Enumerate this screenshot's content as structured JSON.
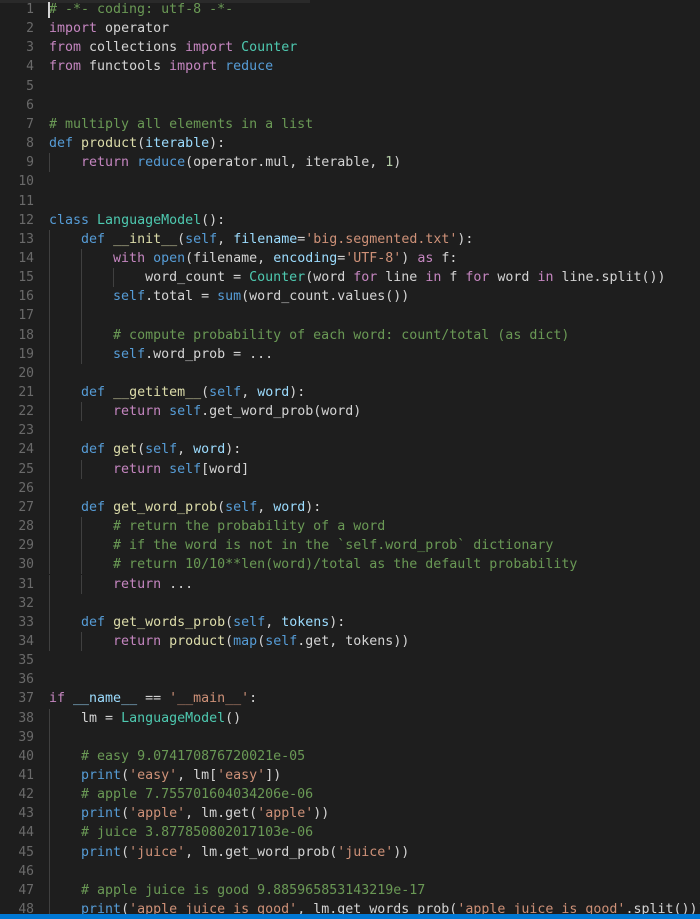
{
  "editor": {
    "language": "python",
    "theme": "dark-plus",
    "background_color": "#1e1e1e",
    "gutter_color": "#6a6a6a",
    "indent_guide_color": "#404040",
    "cursor_line": 1,
    "cursor_column": 1,
    "status_bar_color": "#0078d4",
    "total_visible_lines": 48,
    "colors": {
      "comment": "#6a9955",
      "keyword": "#c586c0",
      "declaration": "#569cd6",
      "string": "#ce9178",
      "function": "#dcdcaa",
      "class": "#4ec9b0",
      "number": "#b5cea8",
      "variable": "#9cdcfe",
      "plain": "#d4d4d4"
    }
  },
  "lines": [
    {
      "n": 1,
      "indent": 0,
      "text": "# -*- coding: utf-8 -*-",
      "tokens": [
        {
          "t": "# -*- coding: utf-8 -*-",
          "c": "t-comment"
        }
      ]
    },
    {
      "n": 2,
      "indent": 0,
      "text": "import operator",
      "tokens": [
        {
          "t": "import",
          "c": "t-keyword"
        },
        {
          "t": " operator",
          "c": "t-plain"
        }
      ]
    },
    {
      "n": 3,
      "indent": 0,
      "text": "from collections import Counter",
      "tokens": [
        {
          "t": "from",
          "c": "t-keyword"
        },
        {
          "t": " collections ",
          "c": "t-plain"
        },
        {
          "t": "import",
          "c": "t-keyword"
        },
        {
          "t": " ",
          "c": "t-plain"
        },
        {
          "t": "Counter",
          "c": "t-builtin"
        }
      ]
    },
    {
      "n": 4,
      "indent": 0,
      "text": "from functools import reduce",
      "tokens": [
        {
          "t": "from",
          "c": "t-keyword"
        },
        {
          "t": " functools ",
          "c": "t-plain"
        },
        {
          "t": "import",
          "c": "t-keyword"
        },
        {
          "t": " ",
          "c": "t-plain"
        },
        {
          "t": "reduce",
          "c": "t-declare"
        }
      ]
    },
    {
      "n": 5,
      "indent": 0,
      "text": "",
      "tokens": []
    },
    {
      "n": 6,
      "indent": 0,
      "text": "",
      "tokens": []
    },
    {
      "n": 7,
      "indent": 0,
      "text": "# multiply all elements in a list",
      "tokens": [
        {
          "t": "# multiply all elements in a list",
          "c": "t-comment"
        }
      ]
    },
    {
      "n": 8,
      "indent": 0,
      "text": "def product(iterable):",
      "tokens": [
        {
          "t": "def",
          "c": "t-declare"
        },
        {
          "t": " ",
          "c": "t-plain"
        },
        {
          "t": "product",
          "c": "t-func"
        },
        {
          "t": "(",
          "c": "t-plain"
        },
        {
          "t": "iterable",
          "c": "t-param"
        },
        {
          "t": "):",
          "c": "t-plain"
        }
      ]
    },
    {
      "n": 9,
      "indent": 1,
      "text": "    return reduce(operator.mul, iterable, 1)",
      "tokens": [
        {
          "t": "    ",
          "c": "t-plain"
        },
        {
          "t": "return",
          "c": "t-ctrl"
        },
        {
          "t": " ",
          "c": "t-plain"
        },
        {
          "t": "reduce",
          "c": "t-declare"
        },
        {
          "t": "(operator.mul, iterable, ",
          "c": "t-plain"
        },
        {
          "t": "1",
          "c": "t-number"
        },
        {
          "t": ")",
          "c": "t-plain"
        }
      ]
    },
    {
      "n": 10,
      "indent": 0,
      "text": "",
      "tokens": []
    },
    {
      "n": 11,
      "indent": 0,
      "text": "",
      "tokens": []
    },
    {
      "n": 12,
      "indent": 0,
      "text": "class LanguageModel():",
      "tokens": [
        {
          "t": "class",
          "c": "t-declare"
        },
        {
          "t": " ",
          "c": "t-plain"
        },
        {
          "t": "LanguageModel",
          "c": "t-class"
        },
        {
          "t": "():",
          "c": "t-plain"
        }
      ]
    },
    {
      "n": 13,
      "indent": 1,
      "text": "    def __init__(self, filename='big.segmented.txt'):",
      "tokens": [
        {
          "t": "    ",
          "c": "t-plain"
        },
        {
          "t": "def",
          "c": "t-declare"
        },
        {
          "t": " ",
          "c": "t-plain"
        },
        {
          "t": "__init__",
          "c": "t-func"
        },
        {
          "t": "(",
          "c": "t-plain"
        },
        {
          "t": "self",
          "c": "t-declare"
        },
        {
          "t": ", ",
          "c": "t-plain"
        },
        {
          "t": "filename",
          "c": "t-param"
        },
        {
          "t": "=",
          "c": "t-plain"
        },
        {
          "t": "'big.segmented.txt'",
          "c": "t-string"
        },
        {
          "t": "):",
          "c": "t-plain"
        }
      ]
    },
    {
      "n": 14,
      "indent": 2,
      "text": "        with open(filename, encoding='UTF-8') as f:",
      "tokens": [
        {
          "t": "        ",
          "c": "t-plain"
        },
        {
          "t": "with",
          "c": "t-keyword"
        },
        {
          "t": " ",
          "c": "t-plain"
        },
        {
          "t": "open",
          "c": "t-declare"
        },
        {
          "t": "(filename, ",
          "c": "t-plain"
        },
        {
          "t": "encoding",
          "c": "t-param"
        },
        {
          "t": "=",
          "c": "t-plain"
        },
        {
          "t": "'UTF-8'",
          "c": "t-string"
        },
        {
          "t": ") ",
          "c": "t-plain"
        },
        {
          "t": "as",
          "c": "t-keyword"
        },
        {
          "t": " f:",
          "c": "t-plain"
        }
      ]
    },
    {
      "n": 15,
      "indent": 3,
      "text": "            word_count = Counter(word for line in f for word in line.split())",
      "tokens": [
        {
          "t": "            word_count = ",
          "c": "t-plain"
        },
        {
          "t": "Counter",
          "c": "t-builtin"
        },
        {
          "t": "(word ",
          "c": "t-plain"
        },
        {
          "t": "for",
          "c": "t-keyword"
        },
        {
          "t": " line ",
          "c": "t-plain"
        },
        {
          "t": "in",
          "c": "t-keyword"
        },
        {
          "t": " f ",
          "c": "t-plain"
        },
        {
          "t": "for",
          "c": "t-keyword"
        },
        {
          "t": " word ",
          "c": "t-plain"
        },
        {
          "t": "in",
          "c": "t-keyword"
        },
        {
          "t": " line.split())",
          "c": "t-plain"
        }
      ]
    },
    {
      "n": 16,
      "indent": 2,
      "text": "        self.total = sum(word_count.values())",
      "tokens": [
        {
          "t": "        ",
          "c": "t-plain"
        },
        {
          "t": "self",
          "c": "t-declare"
        },
        {
          "t": ".total = ",
          "c": "t-plain"
        },
        {
          "t": "sum",
          "c": "t-declare"
        },
        {
          "t": "(word_count.values())",
          "c": "t-plain"
        }
      ]
    },
    {
      "n": 17,
      "indent": 2,
      "text": "",
      "tokens": []
    },
    {
      "n": 18,
      "indent": 2,
      "text": "        # compute probability of each word: count/total (as dict)",
      "tokens": [
        {
          "t": "        ",
          "c": "t-plain"
        },
        {
          "t": "# compute probability of each word: count/total (as dict)",
          "c": "t-comment"
        }
      ]
    },
    {
      "n": 19,
      "indent": 2,
      "text": "        self.word_prob = ...",
      "tokens": [
        {
          "t": "        ",
          "c": "t-plain"
        },
        {
          "t": "self",
          "c": "t-declare"
        },
        {
          "t": ".word_prob = ...",
          "c": "t-plain"
        }
      ]
    },
    {
      "n": 20,
      "indent": 1,
      "text": "",
      "tokens": []
    },
    {
      "n": 21,
      "indent": 1,
      "text": "    def __getitem__(self, word):",
      "tokens": [
        {
          "t": "    ",
          "c": "t-plain"
        },
        {
          "t": "def",
          "c": "t-declare"
        },
        {
          "t": " ",
          "c": "t-plain"
        },
        {
          "t": "__getitem__",
          "c": "t-func"
        },
        {
          "t": "(",
          "c": "t-plain"
        },
        {
          "t": "self",
          "c": "t-declare"
        },
        {
          "t": ", ",
          "c": "t-plain"
        },
        {
          "t": "word",
          "c": "t-param"
        },
        {
          "t": "):",
          "c": "t-plain"
        }
      ]
    },
    {
      "n": 22,
      "indent": 2,
      "text": "        return self.get_word_prob(word)",
      "tokens": [
        {
          "t": "        ",
          "c": "t-plain"
        },
        {
          "t": "return",
          "c": "t-ctrl"
        },
        {
          "t": " ",
          "c": "t-plain"
        },
        {
          "t": "self",
          "c": "t-declare"
        },
        {
          "t": ".get_word_prob(word)",
          "c": "t-plain"
        }
      ]
    },
    {
      "n": 23,
      "indent": 1,
      "text": "",
      "tokens": []
    },
    {
      "n": 24,
      "indent": 1,
      "text": "    def get(self, word):",
      "tokens": [
        {
          "t": "    ",
          "c": "t-plain"
        },
        {
          "t": "def",
          "c": "t-declare"
        },
        {
          "t": " ",
          "c": "t-plain"
        },
        {
          "t": "get",
          "c": "t-func"
        },
        {
          "t": "(",
          "c": "t-plain"
        },
        {
          "t": "self",
          "c": "t-declare"
        },
        {
          "t": ", ",
          "c": "t-plain"
        },
        {
          "t": "word",
          "c": "t-param"
        },
        {
          "t": "):",
          "c": "t-plain"
        }
      ]
    },
    {
      "n": 25,
      "indent": 2,
      "text": "        return self[word]",
      "tokens": [
        {
          "t": "        ",
          "c": "t-plain"
        },
        {
          "t": "return",
          "c": "t-ctrl"
        },
        {
          "t": " ",
          "c": "t-plain"
        },
        {
          "t": "self",
          "c": "t-declare"
        },
        {
          "t": "[word]",
          "c": "t-plain"
        }
      ]
    },
    {
      "n": 26,
      "indent": 1,
      "text": "",
      "tokens": []
    },
    {
      "n": 27,
      "indent": 1,
      "text": "    def get_word_prob(self, word):",
      "tokens": [
        {
          "t": "    ",
          "c": "t-plain"
        },
        {
          "t": "def",
          "c": "t-declare"
        },
        {
          "t": " ",
          "c": "t-plain"
        },
        {
          "t": "get_word_prob",
          "c": "t-func"
        },
        {
          "t": "(",
          "c": "t-plain"
        },
        {
          "t": "self",
          "c": "t-declare"
        },
        {
          "t": ", ",
          "c": "t-plain"
        },
        {
          "t": "word",
          "c": "t-param"
        },
        {
          "t": "):",
          "c": "t-plain"
        }
      ]
    },
    {
      "n": 28,
      "indent": 2,
      "text": "        # return the probability of a word",
      "tokens": [
        {
          "t": "        ",
          "c": "t-plain"
        },
        {
          "t": "# return the probability of a word",
          "c": "t-comment"
        }
      ]
    },
    {
      "n": 29,
      "indent": 2,
      "text": "        # if the word is not in the `self.word_prob` dictionary",
      "tokens": [
        {
          "t": "        ",
          "c": "t-plain"
        },
        {
          "t": "# if the word is not in the `self.word_prob` dictionary",
          "c": "t-comment"
        }
      ]
    },
    {
      "n": 30,
      "indent": 2,
      "text": "        # return 10/10**len(word)/total as the default probability",
      "tokens": [
        {
          "t": "        ",
          "c": "t-plain"
        },
        {
          "t": "# return 10/10**len(word)/total as the default probability",
          "c": "t-comment"
        }
      ]
    },
    {
      "n": 31,
      "indent": 2,
      "text": "        return ...",
      "tokens": [
        {
          "t": "        ",
          "c": "t-plain"
        },
        {
          "t": "return",
          "c": "t-ctrl"
        },
        {
          "t": " ...",
          "c": "t-plain"
        }
      ]
    },
    {
      "n": 32,
      "indent": 1,
      "text": "",
      "tokens": []
    },
    {
      "n": 33,
      "indent": 1,
      "text": "    def get_words_prob(self, tokens):",
      "tokens": [
        {
          "t": "    ",
          "c": "t-plain"
        },
        {
          "t": "def",
          "c": "t-declare"
        },
        {
          "t": " ",
          "c": "t-plain"
        },
        {
          "t": "get_words_prob",
          "c": "t-func"
        },
        {
          "t": "(",
          "c": "t-plain"
        },
        {
          "t": "self",
          "c": "t-declare"
        },
        {
          "t": ", ",
          "c": "t-plain"
        },
        {
          "t": "tokens",
          "c": "t-param"
        },
        {
          "t": "):",
          "c": "t-plain"
        }
      ]
    },
    {
      "n": 34,
      "indent": 2,
      "text": "        return product(map(self.get, tokens))",
      "tokens": [
        {
          "t": "        ",
          "c": "t-plain"
        },
        {
          "t": "return",
          "c": "t-ctrl"
        },
        {
          "t": " ",
          "c": "t-plain"
        },
        {
          "t": "product",
          "c": "t-func"
        },
        {
          "t": "(",
          "c": "t-plain"
        },
        {
          "t": "map",
          "c": "t-declare"
        },
        {
          "t": "(",
          "c": "t-plain"
        },
        {
          "t": "self",
          "c": "t-declare"
        },
        {
          "t": ".get, tokens))",
          "c": "t-plain"
        }
      ]
    },
    {
      "n": 35,
      "indent": 0,
      "text": "",
      "tokens": []
    },
    {
      "n": 36,
      "indent": 0,
      "text": "",
      "tokens": []
    },
    {
      "n": 37,
      "indent": 0,
      "text": "if __name__ == '__main__':",
      "tokens": [
        {
          "t": "if",
          "c": "t-keyword"
        },
        {
          "t": " ",
          "c": "t-plain"
        },
        {
          "t": "__name__",
          "c": "t-param"
        },
        {
          "t": " == ",
          "c": "t-plain"
        },
        {
          "t": "'__main__'",
          "c": "t-string"
        },
        {
          "t": ":",
          "c": "t-plain"
        }
      ]
    },
    {
      "n": 38,
      "indent": 1,
      "text": "    lm = LanguageModel()",
      "tokens": [
        {
          "t": "    lm = ",
          "c": "t-plain"
        },
        {
          "t": "LanguageModel",
          "c": "t-class"
        },
        {
          "t": "()",
          "c": "t-plain"
        }
      ]
    },
    {
      "n": 39,
      "indent": 1,
      "text": "",
      "tokens": []
    },
    {
      "n": 40,
      "indent": 1,
      "text": "    # easy 9.074170876720021e-05",
      "tokens": [
        {
          "t": "    ",
          "c": "t-plain"
        },
        {
          "t": "# easy 9.074170876720021e-05",
          "c": "t-comment"
        }
      ]
    },
    {
      "n": 41,
      "indent": 1,
      "text": "    print('easy', lm['easy'])",
      "tokens": [
        {
          "t": "    ",
          "c": "t-plain"
        },
        {
          "t": "print",
          "c": "t-declare"
        },
        {
          "t": "(",
          "c": "t-plain"
        },
        {
          "t": "'easy'",
          "c": "t-string"
        },
        {
          "t": ", lm[",
          "c": "t-plain"
        },
        {
          "t": "'easy'",
          "c": "t-string"
        },
        {
          "t": "])",
          "c": "t-plain"
        }
      ]
    },
    {
      "n": 42,
      "indent": 1,
      "text": "    # apple 7.755701604034206e-06",
      "tokens": [
        {
          "t": "    ",
          "c": "t-plain"
        },
        {
          "t": "# apple 7.755701604034206e-06",
          "c": "t-comment"
        }
      ]
    },
    {
      "n": 43,
      "indent": 1,
      "text": "    print('apple', lm.get('apple'))",
      "tokens": [
        {
          "t": "    ",
          "c": "t-plain"
        },
        {
          "t": "print",
          "c": "t-declare"
        },
        {
          "t": "(",
          "c": "t-plain"
        },
        {
          "t": "'apple'",
          "c": "t-string"
        },
        {
          "t": ", lm.get(",
          "c": "t-plain"
        },
        {
          "t": "'apple'",
          "c": "t-string"
        },
        {
          "t": "))",
          "c": "t-plain"
        }
      ]
    },
    {
      "n": 44,
      "indent": 1,
      "text": "    # juice 3.877850802017103e-06",
      "tokens": [
        {
          "t": "    ",
          "c": "t-plain"
        },
        {
          "t": "# juice 3.877850802017103e-06",
          "c": "t-comment"
        }
      ]
    },
    {
      "n": 45,
      "indent": 1,
      "text": "    print('juice', lm.get_word_prob('juice'))",
      "tokens": [
        {
          "t": "    ",
          "c": "t-plain"
        },
        {
          "t": "print",
          "c": "t-declare"
        },
        {
          "t": "(",
          "c": "t-plain"
        },
        {
          "t": "'juice'",
          "c": "t-string"
        },
        {
          "t": ", lm.get_word_prob(",
          "c": "t-plain"
        },
        {
          "t": "'juice'",
          "c": "t-string"
        },
        {
          "t": "))",
          "c": "t-plain"
        }
      ]
    },
    {
      "n": 46,
      "indent": 1,
      "text": "",
      "tokens": []
    },
    {
      "n": 47,
      "indent": 1,
      "text": "    # apple juice is good 9.885965853143219e-17",
      "tokens": [
        {
          "t": "    ",
          "c": "t-plain"
        },
        {
          "t": "# apple juice is good 9.885965853143219e-17",
          "c": "t-comment"
        }
      ]
    },
    {
      "n": 48,
      "indent": 1,
      "text": "    print('apple juice is good', lm.get_words_prob('apple juice is good'.split()))",
      "tokens": [
        {
          "t": "    ",
          "c": "t-plain"
        },
        {
          "t": "print",
          "c": "t-declare"
        },
        {
          "t": "(",
          "c": "t-plain"
        },
        {
          "t": "'apple juice is good'",
          "c": "t-string"
        },
        {
          "t": ", lm.get_words_prob(",
          "c": "t-plain"
        },
        {
          "t": "'apple juice is good'",
          "c": "t-string"
        },
        {
          "t": ".split()))",
          "c": "t-plain"
        }
      ]
    }
  ]
}
